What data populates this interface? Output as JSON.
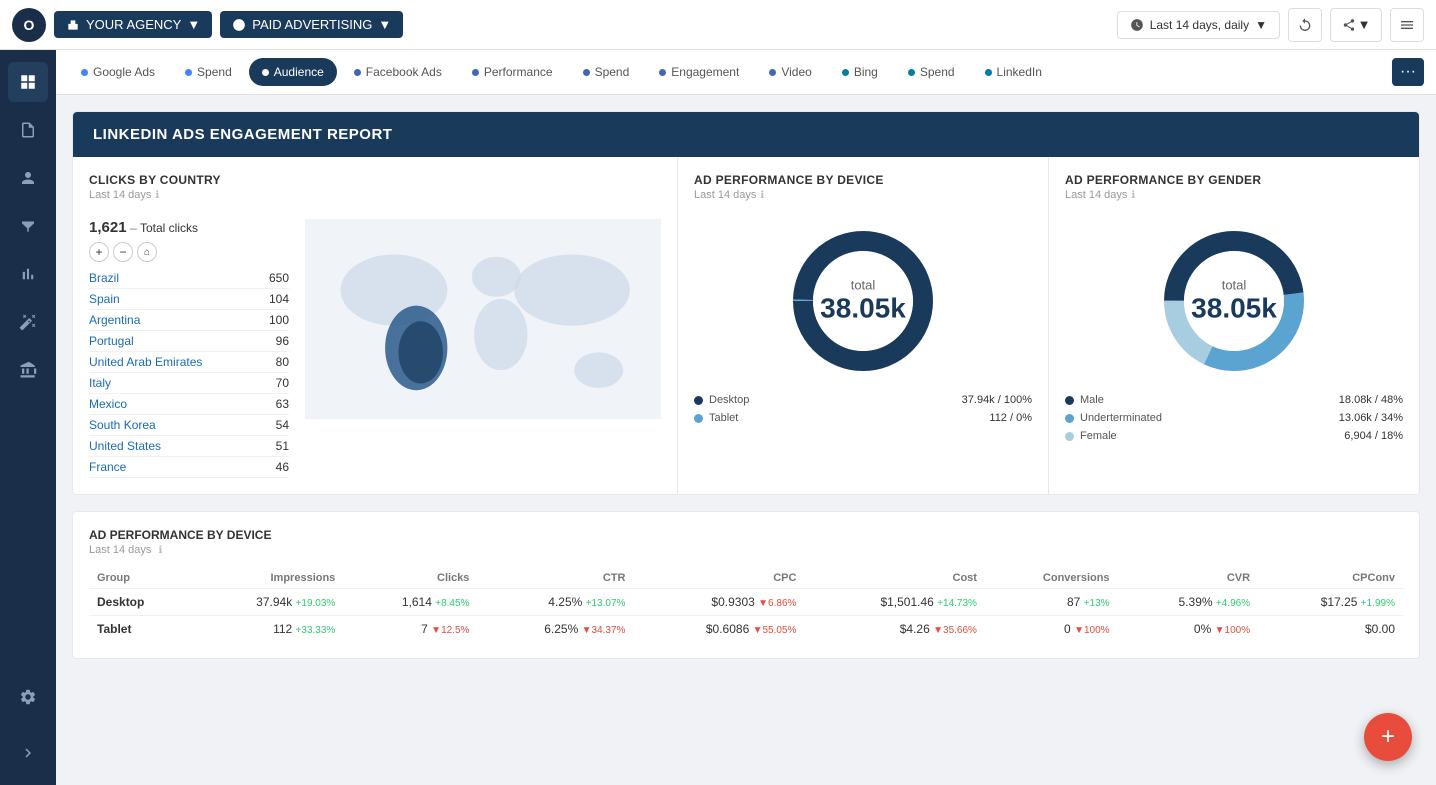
{
  "app": {
    "logo_text": "O"
  },
  "topnav": {
    "agency_label": "YOUR AGENCY",
    "channel_label": "PAID ADVERTISING",
    "date_label": "Last 14 days, daily",
    "dropdown_icon": "▼"
  },
  "tabs": [
    {
      "id": "google-ads",
      "label": "Google Ads",
      "active": false
    },
    {
      "id": "spend1",
      "label": "Spend",
      "active": false
    },
    {
      "id": "audience",
      "label": "Audience",
      "active": true
    },
    {
      "id": "facebook-ads",
      "label": "Facebook Ads",
      "active": false
    },
    {
      "id": "performance",
      "label": "Performance",
      "active": false
    },
    {
      "id": "spend2",
      "label": "Spend",
      "active": false
    },
    {
      "id": "engagement",
      "label": "Engagement",
      "active": false
    },
    {
      "id": "video",
      "label": "Video",
      "active": false
    },
    {
      "id": "bing",
      "label": "Bing",
      "active": false
    },
    {
      "id": "spend3",
      "label": "Spend",
      "active": false
    },
    {
      "id": "linkedin",
      "label": "LinkedIn",
      "active": false
    }
  ],
  "report_title": "LINKEDIN ADS ENGAGEMENT REPORT",
  "clicks_by_country": {
    "title": "CLICKS BY COUNTRY",
    "subtitle": "Last 14 days",
    "total_label": "Total clicks",
    "total_value": "1,621",
    "countries": [
      {
        "name": "Brazil",
        "count": 650
      },
      {
        "name": "Spain",
        "count": 104
      },
      {
        "name": "Argentina",
        "count": 100
      },
      {
        "name": "Portugal",
        "count": 96
      },
      {
        "name": "United Arab Emirates",
        "count": 80
      },
      {
        "name": "Italy",
        "count": 70
      },
      {
        "name": "Mexico",
        "count": 63
      },
      {
        "name": "South Korea",
        "count": 54
      },
      {
        "name": "United States",
        "count": 51
      },
      {
        "name": "France",
        "count": 46
      }
    ]
  },
  "ad_perf_device": {
    "title": "AD PERFORMANCE BY DEVICE",
    "subtitle": "Last 14 days",
    "total_label": "total",
    "total_value": "38.05k",
    "donut": {
      "desktop_pct": 99.7,
      "tablet_pct": 0.3,
      "color_desktop": "#1a3a5c",
      "color_tablet": "#5ba3d0"
    },
    "legend": [
      {
        "label": "Desktop",
        "value": "37.94k",
        "pct": "100%",
        "color": "#1a3a5c"
      },
      {
        "label": "Tablet",
        "value": "112",
        "pct": "0%",
        "color": "#5ba3d0"
      }
    ]
  },
  "ad_perf_gender": {
    "title": "AD PERFORMANCE BY GENDER",
    "subtitle": "Last 14 days",
    "total_label": "total",
    "total_value": "38.05k",
    "donut": {
      "male_pct": 48,
      "underterminated_pct": 34,
      "female_pct": 18,
      "color_male": "#1a3a5c",
      "color_under": "#5ba3d0",
      "color_female": "#a8cce0"
    },
    "legend": [
      {
        "label": "Male",
        "value": "18.08k",
        "pct": "48%",
        "color": "#1a3a5c"
      },
      {
        "label": "Underterminated",
        "value": "13.06k",
        "pct": "34%",
        "color": "#5ba3d0"
      },
      {
        "label": "Female",
        "value": "6,904",
        "pct": "18%",
        "color": "#a8cce0"
      }
    ]
  },
  "table": {
    "title": "AD PERFORMANCE BY DEVICE",
    "subtitle": "Last 14 days",
    "columns": [
      "Group",
      "Impressions",
      "Clicks",
      "CTR",
      "CPC",
      "Cost",
      "Conversions",
      "CVR",
      "CPConv"
    ],
    "rows": [
      {
        "group": "Desktop",
        "impressions": "37.94k",
        "impressions_change": "+19.03%",
        "impressions_up": true,
        "clicks": "1,614",
        "clicks_change": "+8.45%",
        "clicks_up": true,
        "ctr": "4.25%",
        "ctr_change": "+13.07%",
        "ctr_up": true,
        "cpc": "$0.9303",
        "cpc_change": "▼6.86%",
        "cpc_up": false,
        "cost": "$1,501.46",
        "cost_change": "+14.73%",
        "cost_up": true,
        "conversions": "87",
        "conversions_change": "+13%",
        "conversions_up": true,
        "cvr": "5.39%",
        "cvr_change": "+4.96%",
        "cvr_up": true,
        "cpconv": "$17.25",
        "cpconv_change": "+1.99%",
        "cpconv_up": true
      },
      {
        "group": "Tablet",
        "impressions": "112",
        "impressions_change": "+33.33%",
        "impressions_up": true,
        "clicks": "7",
        "clicks_change": "▼12.5%",
        "clicks_up": false,
        "ctr": "6.25%",
        "ctr_change": "▼34.37%",
        "ctr_up": false,
        "cpc": "$0.6086",
        "cpc_change": "▼55.05%",
        "cpc_up": false,
        "cost": "$4.26",
        "cost_change": "▼35.66%",
        "cost_up": false,
        "conversions": "0",
        "conversions_change": "▼100%",
        "conversions_up": false,
        "cvr": "0%",
        "cvr_change": "▼100%",
        "cvr_up": false,
        "cpconv": "$0.00",
        "cpconv_change": "",
        "cpconv_up": true
      }
    ]
  },
  "sidebar": {
    "items": [
      {
        "id": "dashboard",
        "icon": "grid"
      },
      {
        "id": "reports",
        "icon": "file"
      },
      {
        "id": "audience",
        "icon": "person"
      },
      {
        "id": "filter",
        "icon": "filter"
      },
      {
        "id": "chart",
        "icon": "chart"
      },
      {
        "id": "magic",
        "icon": "magic"
      },
      {
        "id": "bank",
        "icon": "bank"
      },
      {
        "id": "settings",
        "icon": "settings"
      }
    ]
  },
  "fab_label": "+"
}
